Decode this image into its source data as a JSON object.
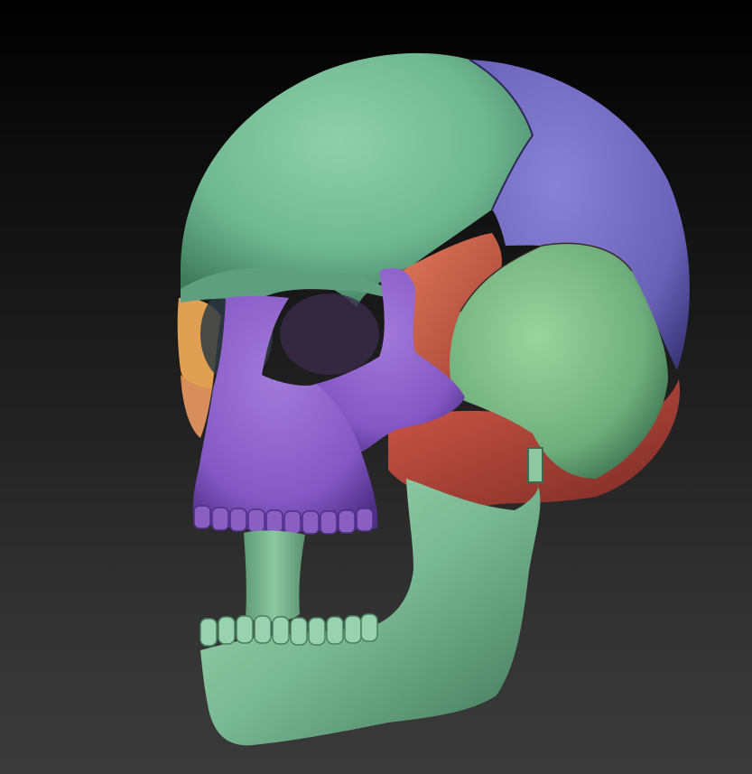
{
  "scene": {
    "subject": "sculpted-skull-model",
    "background": {
      "top": "#000000",
      "bottom": "#3a3a3a"
    },
    "bone_colors": {
      "frontal": "#6fb892",
      "parietal": "#6a62b8",
      "sphenoid": "#c65a44",
      "temporal": "#6fae7c",
      "maxilla": "#8a5fc2",
      "zygomatic": "#8458c4",
      "nasal": "#d88e5a",
      "lacrimal": "#e0a052",
      "mandible": "#78b892",
      "occipital": "#b04a3e",
      "spine": "#74b08c"
    }
  }
}
